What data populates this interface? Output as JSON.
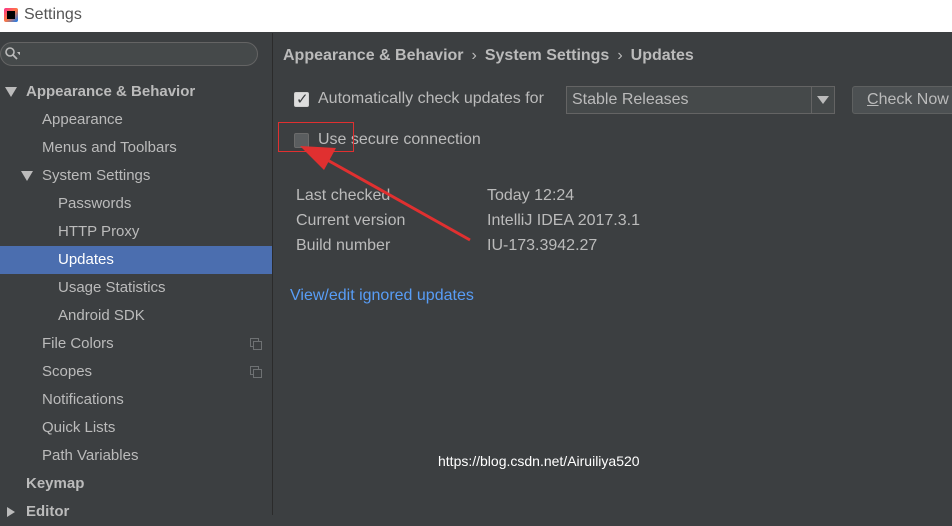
{
  "window": {
    "title": "Settings"
  },
  "sidebar": {
    "search": {
      "placeholder": ""
    },
    "items": [
      {
        "label": "Appearance & Behavior",
        "bold": true,
        "level": 0,
        "expanded": true
      },
      {
        "label": "Appearance",
        "level": 1
      },
      {
        "label": "Menus and Toolbars",
        "level": 1
      },
      {
        "label": "System Settings",
        "level": 1,
        "expanded": true
      },
      {
        "label": "Passwords",
        "level": 2
      },
      {
        "label": "HTTP Proxy",
        "level": 2
      },
      {
        "label": "Updates",
        "level": 2,
        "selected": true
      },
      {
        "label": "Usage Statistics",
        "level": 2
      },
      {
        "label": "Android SDK",
        "level": 2
      },
      {
        "label": "File Colors",
        "level": 1,
        "has_copy_icon": true
      },
      {
        "label": "Scopes",
        "level": 1,
        "has_copy_icon": true
      },
      {
        "label": "Notifications",
        "level": 1
      },
      {
        "label": "Quick Lists",
        "level": 1
      },
      {
        "label": "Path Variables",
        "level": 1
      },
      {
        "label": "Keymap",
        "bold": true,
        "level": 0
      },
      {
        "label": "Editor",
        "bold": true,
        "level": 0,
        "collapsed": true
      }
    ]
  },
  "main": {
    "breadcrumb": [
      "Appearance & Behavior",
      "System Settings",
      "Updates"
    ],
    "breadcrumb_sep": "›",
    "auto_check": {
      "label": "Automatically check updates for",
      "checked": true
    },
    "channel": {
      "value": "Stable Releases"
    },
    "check_now_label": "Check Now",
    "secure": {
      "label": "Use secure connection",
      "checked": false
    },
    "info": [
      {
        "key": "Last checked",
        "value": "Today 12:24"
      },
      {
        "key": "Current version",
        "value": "IntelliJ IDEA 2017.3.1"
      },
      {
        "key": "Build number",
        "value": "IU-173.3942.27"
      }
    ],
    "ignored_link": "View/edit ignored updates"
  },
  "watermark": "https://blog.csdn.net/Airuiliya520",
  "colors": {
    "background": "#3c3f41",
    "selection": "#4b6eaf",
    "link": "#589df6",
    "annotation_red": "#e03030"
  }
}
